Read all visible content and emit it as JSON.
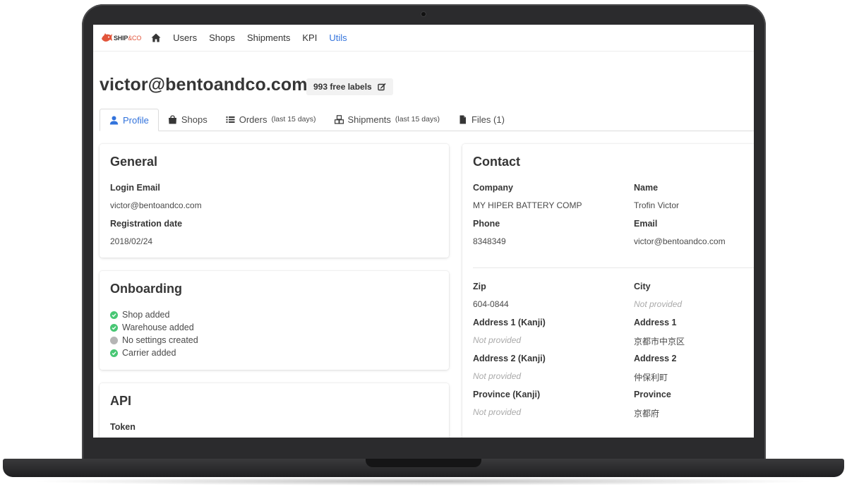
{
  "brand": {
    "name": "SHIP",
    "suffix": "&CO"
  },
  "nav": {
    "items": [
      {
        "label": "Users",
        "active": false
      },
      {
        "label": "Shops",
        "active": false
      },
      {
        "label": "Shipments",
        "active": false
      },
      {
        "label": "KPI",
        "active": false
      },
      {
        "label": "Utils",
        "active": true
      }
    ]
  },
  "header": {
    "title": "victor@bentoandco.com",
    "free_labels": "993 free labels"
  },
  "tabs": [
    {
      "label": "Profile",
      "note": "",
      "icon": "user-icon",
      "active": true
    },
    {
      "label": "Shops",
      "note": "",
      "icon": "bag-icon",
      "active": false
    },
    {
      "label": "Orders",
      "note": "(last 15 days)",
      "icon": "list-icon",
      "active": false
    },
    {
      "label": "Shipments",
      "note": "(last 15 days)",
      "icon": "boxes-icon",
      "active": false
    },
    {
      "label": "Files (1)",
      "note": "",
      "icon": "file-icon",
      "active": false
    }
  ],
  "general": {
    "title": "General",
    "login_email_label": "Login Email",
    "login_email": "victor@bentoandco.com",
    "registration_label": "Registration date",
    "registration_date": "2018/02/24"
  },
  "onboarding": {
    "title": "Onboarding",
    "items": [
      {
        "label": "Shop added",
        "done": true
      },
      {
        "label": "Warehouse added",
        "done": true
      },
      {
        "label": "No settings created",
        "done": false
      },
      {
        "label": "Carrier added",
        "done": true
      }
    ]
  },
  "api": {
    "title": "API",
    "token_label": "Token"
  },
  "contact": {
    "title": "Contact",
    "company_label": "Company",
    "company": "MY HIPER BATTERY COMP",
    "name_label": "Name",
    "name": "Trofin Victor",
    "phone_label": "Phone",
    "phone": "8348349",
    "email_label": "Email",
    "email": "victor@bentoandco.com",
    "zip_label": "Zip",
    "zip": "604-0844",
    "city_label": "City",
    "city": "Not provided",
    "address1_kanji_label": "Address 1 (Kanji)",
    "address1_kanji": "Not provided",
    "address1_label": "Address 1",
    "address1": "京都市中京区",
    "address2_kanji_label": "Address 2 (Kanji)",
    "address2_kanji": "Not provided",
    "address2_label": "Address 2",
    "address2": "仲保利町",
    "province_kanji_label": "Province (Kanji)",
    "province_kanji": "Not provided",
    "province_label": "Province",
    "province": "京都府"
  },
  "colors": {
    "accent": "#3273dc",
    "success": "#48c774",
    "inactive": "#b5b5b5",
    "brand_orange": "#e2553b"
  }
}
